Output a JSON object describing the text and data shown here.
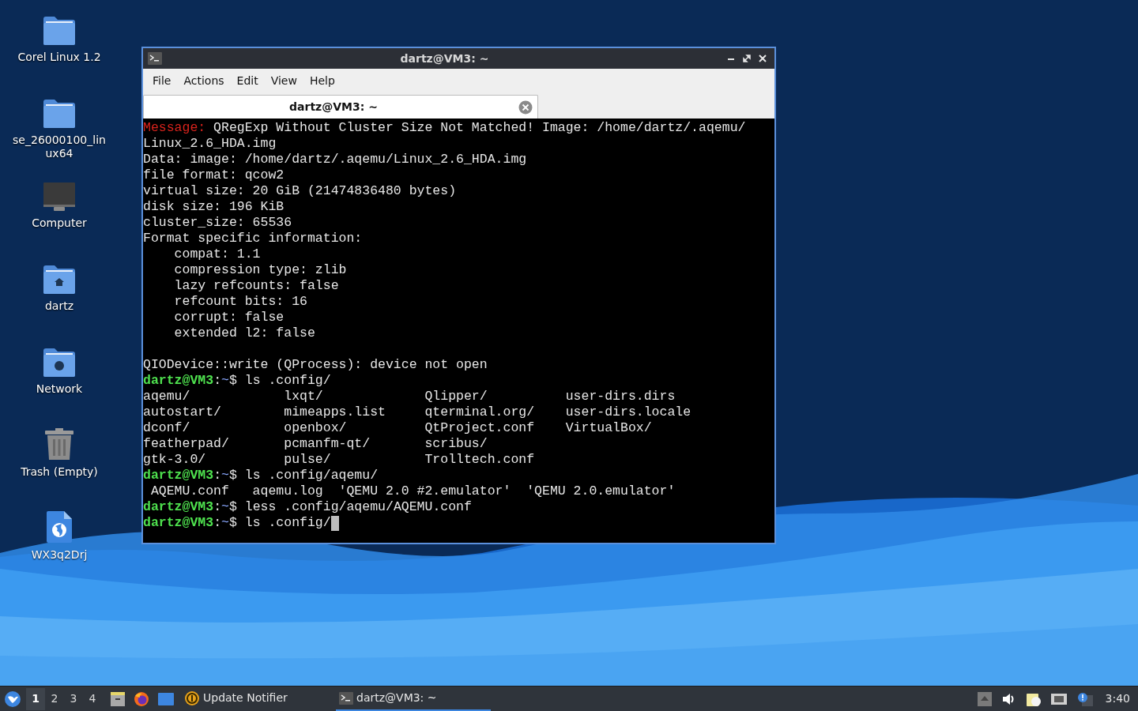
{
  "desktop_icons": [
    {
      "label": "Corel Linux 1.2",
      "kind": "folder"
    },
    {
      "label": "se_26000100_lin ux64",
      "kind": "folder"
    },
    {
      "label": "Computer",
      "kind": "computer"
    },
    {
      "label": "dartz",
      "kind": "home"
    },
    {
      "label": "Network",
      "kind": "network"
    },
    {
      "label": "Trash (Empty)",
      "kind": "trash"
    },
    {
      "label": "WX3q2Drj",
      "kind": "web-file"
    }
  ],
  "terminal": {
    "title": "dartz@VM3: ~",
    "menu": [
      "File",
      "Actions",
      "Edit",
      "View",
      "Help"
    ],
    "tabs": [
      {
        "label": "dartz@VM3: ~",
        "selected": true
      }
    ],
    "lines": [
      {
        "kind": "message",
        "label": "Message:",
        "text": " QRegExp Without Cluster Size Not Matched! Image: /home/dartz/.aqemu/"
      },
      {
        "kind": "text",
        "text": "Linux_2.6_HDA.img"
      },
      {
        "kind": "text",
        "text": "Data: image: /home/dartz/.aqemu/Linux_2.6_HDA.img"
      },
      {
        "kind": "text",
        "text": "file format: qcow2"
      },
      {
        "kind": "text",
        "text": "virtual size: 20 GiB (21474836480 bytes)"
      },
      {
        "kind": "text",
        "text": "disk size: 196 KiB"
      },
      {
        "kind": "text",
        "text": "cluster_size: 65536"
      },
      {
        "kind": "text",
        "text": "Format specific information:"
      },
      {
        "kind": "text",
        "text": "    compat: 1.1"
      },
      {
        "kind": "text",
        "text": "    compression type: zlib"
      },
      {
        "kind": "text",
        "text": "    lazy refcounts: false"
      },
      {
        "kind": "text",
        "text": "    refcount bits: 16"
      },
      {
        "kind": "text",
        "text": "    corrupt: false"
      },
      {
        "kind": "text",
        "text": "    extended l2: false"
      },
      {
        "kind": "blank"
      },
      {
        "kind": "text",
        "text": "QIODevice::write (QProcess): device not open"
      },
      {
        "kind": "prompt",
        "user": "dartz@VM3",
        "sep": ":",
        "path": "~",
        "symbol": "$",
        "command": " ls .config/"
      },
      {
        "kind": "text",
        "text": "aqemu/            lxqt/             Qlipper/          user-dirs.dirs"
      },
      {
        "kind": "text",
        "text": "autostart/        mimeapps.list     qterminal.org/    user-dirs.locale"
      },
      {
        "kind": "text",
        "text": "dconf/            openbox/          QtProject.conf    VirtualBox/"
      },
      {
        "kind": "text",
        "text": "featherpad/       pcmanfm-qt/       scribus/"
      },
      {
        "kind": "text",
        "text": "gtk-3.0/          pulse/            Trolltech.conf"
      },
      {
        "kind": "prompt",
        "user": "dartz@VM3",
        "sep": ":",
        "path": "~",
        "symbol": "$",
        "command": " ls .config/aqemu/"
      },
      {
        "kind": "text",
        "text": " AQEMU.conf   aqemu.log  'QEMU 2.0 #2.emulator'  'QEMU 2.0.emulator'"
      },
      {
        "kind": "prompt",
        "user": "dartz@VM3",
        "sep": ":",
        "path": "~",
        "symbol": "$",
        "command": " less .config/aqemu/AQEMU.conf"
      },
      {
        "kind": "prompt",
        "user": "dartz@VM3",
        "sep": ":",
        "path": "~",
        "symbol": "$",
        "command": " ls .config/",
        "cursor": true
      }
    ]
  },
  "taskbar": {
    "desktops": [
      {
        "label": "1",
        "selected": true
      },
      {
        "label": "2",
        "selected": false
      },
      {
        "label": "3",
        "selected": false
      },
      {
        "label": "4",
        "selected": false
      }
    ],
    "launchers": [
      {
        "kind": "files"
      },
      {
        "kind": "browser"
      },
      {
        "kind": "desktop"
      }
    ],
    "tasks": [
      {
        "label": "Update Notifier",
        "kind": "updater",
        "selected": false
      },
      {
        "label": "dartz@VM3: ~",
        "kind": "terminal",
        "selected": true
      }
    ],
    "clock": "3:40"
  }
}
